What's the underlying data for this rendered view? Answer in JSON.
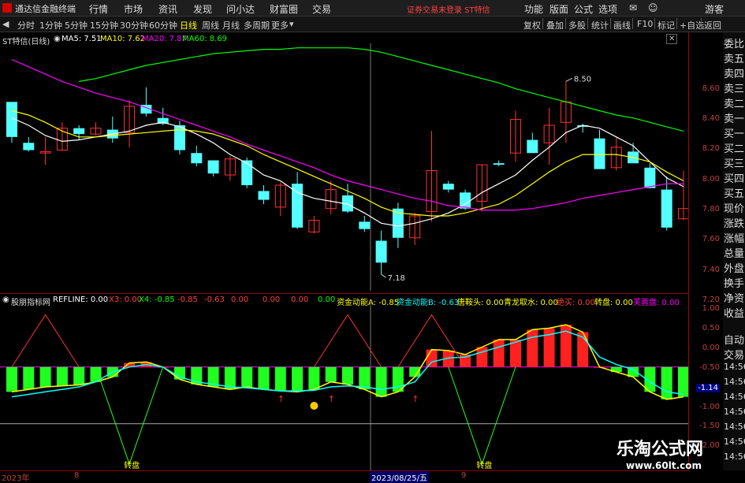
{
  "menubar": {
    "app_title": "通达信金融终端",
    "items": [
      "行情",
      "市场",
      "资讯",
      "发现",
      "问小达",
      "财富圈",
      "交易"
    ],
    "warning": "证券交易未登录  ST特信",
    "right_items": [
      "功能",
      "版面",
      "公式",
      "选项"
    ],
    "user": "游客"
  },
  "toolbar": {
    "periods": [
      "分时",
      "1分钟",
      "5分钟",
      "15分钟",
      "30分钟",
      "60分钟",
      "日线",
      "周线",
      "月线",
      "多周期",
      "更多"
    ],
    "active_period": "日线",
    "right_buttons": [
      "复权",
      "叠加",
      "多股",
      "统计",
      "画线",
      "F10",
      "标记",
      "+自选",
      "返回"
    ]
  },
  "main_chart": {
    "stock_title": "ST特信(日线)",
    "ma_labels": [
      {
        "text": "MA5: 7.51",
        "color": "#ffffff"
      },
      {
        "text": "MA10: 7.62",
        "color": "#ffff00"
      },
      {
        "text": "MA20: 7.87",
        "color": "#ff00ff"
      },
      {
        "text": "MA60: 8.69",
        "color": "#00ff00"
      }
    ],
    "high_label": "8.50",
    "low_label": "7.18",
    "price_ticks": [
      "8.60",
      "8.40",
      "8.20",
      "8.00",
      "7.80",
      "7.60",
      "7.40",
      "7.20"
    ]
  },
  "sub_chart": {
    "indicator_name": "股朋指标网",
    "labels": [
      {
        "text": "REFLINE: 0.00",
        "color": "#ffffff"
      },
      {
        "text": "X3: 0.00",
        "color": "#ff4040"
      },
      {
        "text": "X4: -0.85",
        "color": "#00ff00"
      },
      {
        "text": "-0.85",
        "color": "#ff4040"
      },
      {
        "text": "-0.63",
        "color": "#ff4040"
      },
      {
        "text": "0.00",
        "color": "#ff4040"
      },
      {
        "text": "0.00",
        "color": "#ff4040"
      },
      {
        "text": "0.00",
        "color": "#ff4040"
      },
      {
        "text": "0.00",
        "color": "#00ff00"
      },
      {
        "text": "资金动能A: -0.85",
        "color": "#ffff00"
      },
      {
        "text": "资金动能B: -0.63",
        "color": "#00ffff"
      },
      {
        "text": "唐鞍头: 0.00",
        "color": "#ffff00"
      },
      {
        "text": "青龙取水: 0.00",
        "color": "#ffff00"
      },
      {
        "text": "绝买: 0.00",
        "color": "#ff4040"
      },
      {
        "text": "转盘: 0.00",
        "color": "#ffff00"
      },
      {
        "text": "芙蓉盘: 0.00",
        "color": "#ff00ff"
      }
    ],
    "ticks": [
      "1.00",
      "0.50",
      "0.00",
      "-0.50",
      "-1.00",
      "-1.50",
      "-2.00"
    ],
    "current_value": "-1.14",
    "turn_label": "转盘"
  },
  "right_nav": [
    "委比",
    "卖五",
    "卖四",
    "卖三",
    "卖二",
    "卖一",
    "买一",
    "买二",
    "买三",
    "买四",
    "买五",
    "现价",
    "涨跌",
    "涨幅",
    "总量",
    "外盘",
    "换手",
    "净资",
    "收益",
    "自动",
    "交易"
  ],
  "time_ticks": [
    "14:56",
    "14:56",
    "14:56",
    "14:56",
    "14:56",
    "14:56",
    "14:56"
  ],
  "bottom_dates": {
    "year": "2023年",
    "m1": "8",
    "selected": "2023/08/25/五",
    "m2": "9"
  },
  "watermark": {
    "line1": "乐淘公式网",
    "line2": "www.60lt.com"
  },
  "colors": {
    "up": "#ff3232",
    "down": "#54ffff",
    "ma5": "#ffffff",
    "ma10": "#ffff00",
    "ma20": "#ff00ff",
    "ma60": "#00ff00",
    "bg": "#000000"
  },
  "chart_data": [
    {
      "type": "candlestick",
      "title": "ST特信(日线)",
      "ylim": [
        7.1,
        8.75
      ],
      "candles": [
        {
          "o": 8.36,
          "h": 8.36,
          "l": 8.08,
          "c": 8.12
        },
        {
          "o": 8.08,
          "h": 8.12,
          "l": 8.02,
          "c": 8.03
        },
        {
          "o": 8.01,
          "h": 8.12,
          "l": 7.93,
          "c": 8.02
        },
        {
          "o": 8.03,
          "h": 8.22,
          "l": 8.03,
          "c": 8.18
        },
        {
          "o": 8.18,
          "h": 8.2,
          "l": 8.1,
          "c": 8.14
        },
        {
          "o": 8.14,
          "h": 8.22,
          "l": 8.13,
          "c": 8.18
        },
        {
          "o": 8.17,
          "h": 8.26,
          "l": 8.08,
          "c": 8.11
        },
        {
          "o": 8.15,
          "h": 8.37,
          "l": 8.05,
          "c": 8.33
        },
        {
          "o": 8.34,
          "h": 8.46,
          "l": 8.26,
          "c": 8.28
        },
        {
          "o": 8.25,
          "h": 8.32,
          "l": 8.2,
          "c": 8.21
        },
        {
          "o": 8.2,
          "h": 8.23,
          "l": 8.0,
          "c": 8.03
        },
        {
          "o": 8.01,
          "h": 8.06,
          "l": 7.92,
          "c": 7.94
        },
        {
          "o": 7.96,
          "h": 7.96,
          "l": 7.85,
          "c": 7.87
        },
        {
          "o": 7.86,
          "h": 7.99,
          "l": 7.82,
          "c": 7.97
        },
        {
          "o": 7.96,
          "h": 7.98,
          "l": 7.77,
          "c": 7.79
        },
        {
          "o": 7.75,
          "h": 7.79,
          "l": 7.66,
          "c": 7.69
        },
        {
          "o": 7.64,
          "h": 7.81,
          "l": 7.58,
          "c": 7.79
        },
        {
          "o": 7.8,
          "h": 7.88,
          "l": 7.49,
          "c": 7.5
        },
        {
          "o": 7.47,
          "h": 7.58,
          "l": 7.46,
          "c": 7.55
        },
        {
          "o": 7.63,
          "h": 7.82,
          "l": 7.59,
          "c": 7.76
        },
        {
          "o": 7.72,
          "h": 7.8,
          "l": 7.6,
          "c": 7.61
        },
        {
          "o": 7.54,
          "h": 7.58,
          "l": 7.47,
          "c": 7.49
        },
        {
          "o": 7.41,
          "h": 7.48,
          "l": 7.18,
          "c": 7.26
        },
        {
          "o": 7.63,
          "h": 7.67,
          "l": 7.36,
          "c": 7.43
        },
        {
          "o": 7.43,
          "h": 7.6,
          "l": 7.38,
          "c": 7.58
        },
        {
          "o": 7.61,
          "h": 8.16,
          "l": 7.54,
          "c": 7.89
        },
        {
          "o": 7.8,
          "h": 7.82,
          "l": 7.74,
          "c": 7.76
        },
        {
          "o": 7.74,
          "h": 7.76,
          "l": 7.62,
          "c": 7.63
        },
        {
          "o": 7.68,
          "h": 7.93,
          "l": 7.61,
          "c": 7.93
        },
        {
          "o": 7.94,
          "h": 7.96,
          "l": 7.92,
          "c": 7.93
        },
        {
          "o": 8.01,
          "h": 8.3,
          "l": 7.95,
          "c": 8.24
        },
        {
          "o": 8.1,
          "h": 8.15,
          "l": 8.01,
          "c": 8.01
        },
        {
          "o": 8.08,
          "h": 8.32,
          "l": 7.93,
          "c": 8.2
        },
        {
          "o": 8.22,
          "h": 8.5,
          "l": 8.08,
          "c": 8.36
        },
        {
          "o": 8.2,
          "h": 8.21,
          "l": 8.15,
          "c": 8.19
        },
        {
          "o": 8.11,
          "h": 8.17,
          "l": 7.9,
          "c": 7.9
        },
        {
          "o": 7.91,
          "h": 8.12,
          "l": 7.89,
          "c": 8.05
        },
        {
          "o": 8.02,
          "h": 8.08,
          "l": 7.95,
          "c": 7.94
        },
        {
          "o": 7.91,
          "h": 7.94,
          "l": 7.77,
          "c": 7.77
        },
        {
          "o": 7.76,
          "h": 7.85,
          "l": 7.48,
          "c": 7.5
        },
        {
          "o": 7.56,
          "h": 7.89,
          "l": 7.55,
          "c": 7.63
        }
      ],
      "series": [
        {
          "name": "MA5",
          "values": [
            8.25,
            8.2,
            8.13,
            8.09,
            8.1,
            8.12,
            8.14,
            8.16,
            8.2,
            8.22,
            8.19,
            8.14,
            8.08,
            8.0,
            7.94,
            7.86,
            7.82,
            7.74,
            7.7,
            7.68,
            7.66,
            7.6,
            7.53,
            7.51,
            7.53,
            7.56,
            7.6,
            7.66,
            7.74,
            7.8,
            7.86,
            7.96,
            8.05,
            8.15,
            8.2,
            8.18,
            8.12,
            8.06,
            7.95,
            7.84,
            7.78
          ]
        },
        {
          "name": "MA10",
          "values": [
            8.3,
            8.27,
            8.22,
            8.16,
            8.12,
            8.12,
            8.13,
            8.14,
            8.15,
            8.16,
            8.17,
            8.16,
            8.14,
            8.1,
            8.06,
            8.0,
            7.95,
            7.9,
            7.85,
            7.8,
            7.75,
            7.7,
            7.64,
            7.6,
            7.59,
            7.58,
            7.58,
            7.6,
            7.63,
            7.66,
            7.72,
            7.8,
            7.88,
            7.95,
            8.0,
            8.0,
            8.0,
            7.98,
            7.95,
            7.88,
            7.82
          ]
        },
        {
          "name": "MA20",
          "values": [
            8.65,
            8.6,
            8.55,
            8.5,
            8.46,
            8.42,
            8.39,
            8.36,
            8.32,
            8.28,
            8.24,
            8.2,
            8.16,
            8.12,
            8.07,
            8.03,
            7.99,
            7.95,
            7.91,
            7.86,
            7.82,
            7.79,
            7.76,
            7.73,
            7.7,
            7.68,
            7.65,
            7.64,
            7.62,
            7.62,
            7.62,
            7.63,
            7.65,
            7.67,
            7.7,
            7.72,
            7.74,
            7.76,
            7.78,
            7.8,
            7.8
          ]
        },
        {
          "name": "MA60",
          "values": [
            null,
            null,
            null,
            null,
            8.5,
            8.52,
            8.55,
            8.58,
            8.61,
            8.63,
            8.65,
            8.67,
            8.69,
            8.7,
            8.71,
            8.72,
            8.72,
            8.73,
            8.73,
            8.73,
            8.73,
            8.72,
            8.7,
            8.67,
            8.64,
            8.61,
            8.58,
            8.55,
            8.52,
            8.49,
            8.45,
            8.42,
            8.39,
            8.36,
            8.33,
            8.3,
            8.27,
            8.25,
            8.22,
            8.19,
            8.16
          ]
        }
      ]
    },
    {
      "type": "bar",
      "title": "股朋指标网",
      "ylim": [
        -2.0,
        1.2
      ],
      "values": [
        -0.5,
        -0.45,
        -0.4,
        -0.38,
        -0.36,
        -0.3,
        -0.2,
        0.08,
        0.1,
        0.0,
        -0.25,
        -0.35,
        -0.4,
        -0.45,
        -0.4,
        -0.45,
        -0.48,
        -0.5,
        -0.45,
        -0.3,
        -0.35,
        -0.45,
        -0.6,
        -0.5,
        -0.2,
        0.35,
        0.33,
        0.25,
        0.4,
        0.55,
        0.55,
        0.75,
        0.78,
        0.85,
        0.7,
        0.0,
        -0.1,
        -0.2,
        -0.5,
        -0.65,
        -0.6
      ],
      "series": [
        {
          "name": "资金动能A",
          "values": [
            -0.5,
            -0.45,
            -0.4,
            -0.38,
            -0.36,
            -0.3,
            -0.2,
            0.08,
            0.1,
            0.0,
            -0.25,
            -0.35,
            -0.4,
            -0.45,
            -0.4,
            -0.45,
            -0.48,
            -0.5,
            -0.45,
            -0.3,
            -0.35,
            -0.45,
            -0.6,
            -0.5,
            -0.2,
            0.35,
            0.33,
            0.25,
            0.4,
            0.55,
            0.55,
            0.75,
            0.78,
            0.85,
            0.7,
            0.0,
            -0.1,
            -0.2,
            -0.5,
            -0.65,
            -0.6
          ]
        },
        {
          "name": "资金动能B",
          "values": [
            -0.6,
            -0.55,
            -0.5,
            -0.45,
            -0.4,
            -0.3,
            -0.1,
            0.0,
            0.05,
            0.0,
            -0.2,
            -0.3,
            -0.35,
            -0.4,
            -0.42,
            -0.45,
            -0.48,
            -0.48,
            -0.47,
            -0.4,
            -0.38,
            -0.4,
            -0.45,
            -0.4,
            -0.3,
            0.1,
            0.18,
            0.2,
            0.3,
            0.4,
            0.5,
            0.6,
            0.65,
            0.72,
            0.6,
            0.2,
            0.05,
            -0.05,
            -0.3,
            -0.5,
            -0.55
          ]
        }
      ]
    }
  ]
}
